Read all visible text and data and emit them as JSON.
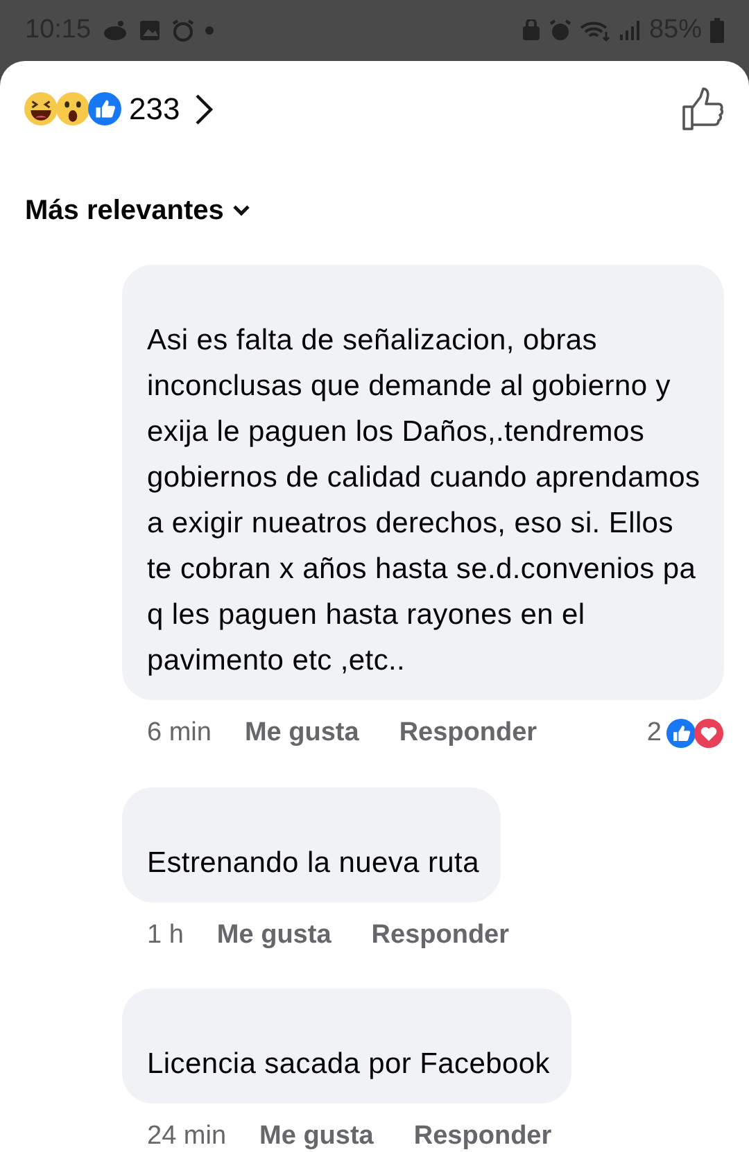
{
  "status_bar": {
    "time": "10:15",
    "battery": "85%"
  },
  "reactions": {
    "kinds": [
      {
        "kind": "haha"
      },
      {
        "kind": "wow"
      },
      {
        "kind": "like"
      }
    ],
    "count": "233"
  },
  "sort": {
    "label": "Más relevantes"
  },
  "comments": [
    {
      "text": "Asi es falta de señalizacion, obras inconclusas que demande al gobierno y exija le paguen los Daños,.tendremos gobiernos de calidad cuando aprendamos a exigir nueatros derechos, eso si. Ellos te cobran x años hasta se.d.convenios pa q les paguen hasta rayones en el pavimento etc ,etc..",
      "time": "6 min",
      "like": "Me gusta",
      "reply": "Responder",
      "reaction_count": "2",
      "reaction_kinds": [
        {
          "kind": "like"
        },
        {
          "kind": "love"
        }
      ]
    },
    {
      "text": "Estrenando la nueva ruta",
      "time": "1 h",
      "like": "Me gusta",
      "reply": "Responder"
    },
    {
      "text": "Licencia sacada por Facebook",
      "time": "24 min",
      "like": "Me gusta",
      "reply": "Responder"
    }
  ]
}
